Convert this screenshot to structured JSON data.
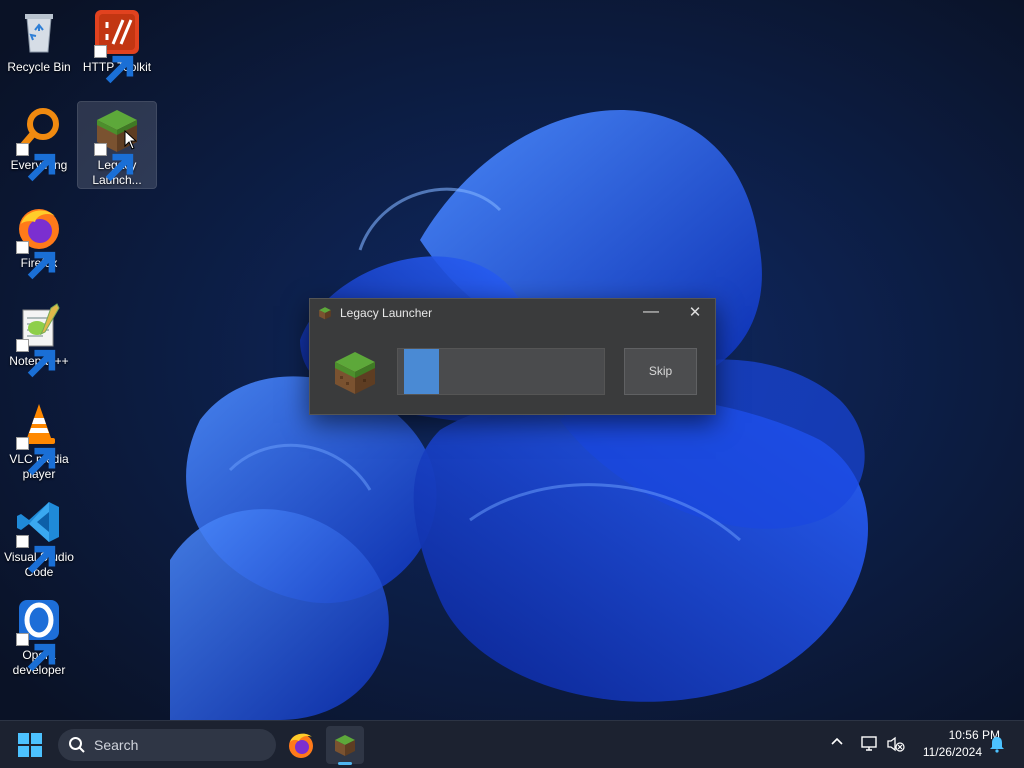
{
  "desktop": {
    "icons": [
      {
        "label": "Recycle Bin",
        "icon": "recycle-bin-icon"
      },
      {
        "label": "HTTP Toolkit",
        "icon": "http-toolkit-icon"
      },
      {
        "label": "Everything",
        "icon": "everything-search-icon"
      },
      {
        "label": "Legacy Launch...",
        "label_line1": "Legacy",
        "label_line2": "Launch...",
        "icon": "minecraft-grass-block-icon"
      },
      {
        "label": "Firefox",
        "icon": "firefox-icon"
      },
      {
        "label": "Notepad++",
        "icon": "notepad-plus-plus-icon"
      },
      {
        "label_line1": "VLC media",
        "label_line2": "player",
        "icon": "vlc-cone-icon"
      },
      {
        "label_line1": "Visual Studio",
        "label_line2": "Code",
        "icon": "vscode-icon"
      },
      {
        "label_line1": "Opera",
        "label_line2": "developer",
        "icon": "opera-developer-icon"
      }
    ]
  },
  "dialog": {
    "title": "Legacy Launcher",
    "progress_fraction": 0.17,
    "skip_label": "Skip",
    "minimize_glyph": "—",
    "close_glyph": "✕"
  },
  "taskbar": {
    "search_placeholder": "Search",
    "apps": [
      {
        "name": "Firefox",
        "icon": "firefox-icon"
      },
      {
        "name": "Legacy Launcher",
        "icon": "minecraft-grass-block-icon",
        "active": true
      }
    ],
    "tray": {
      "chevron_glyph": "^",
      "time": "10:56 PM",
      "date": "11/26/2024"
    }
  },
  "colors": {
    "accent": "#4a8ad4",
    "wallpaper_bg": "#0b1427",
    "bloom_blue": "#1e5bf0",
    "taskbar_bg": "#1c2230"
  }
}
